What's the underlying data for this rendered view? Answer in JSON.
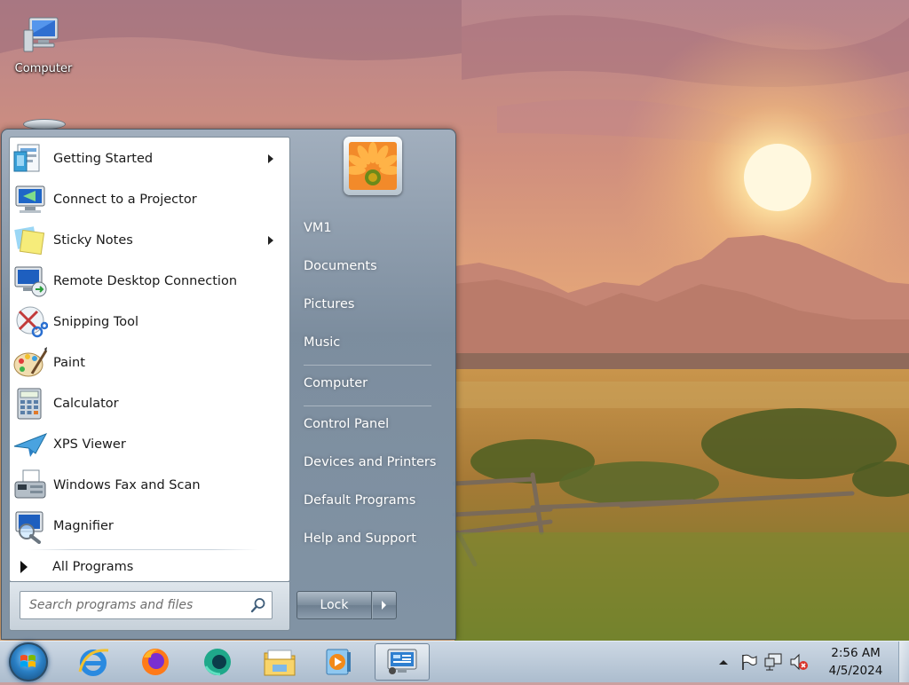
{
  "desktop": {
    "icons": [
      {
        "label": "Computer"
      }
    ]
  },
  "start_menu": {
    "programs": [
      {
        "label": "Getting Started",
        "icon": "getting-started-icon",
        "has_submenu": true
      },
      {
        "label": "Connect to a Projector",
        "icon": "projector-icon",
        "has_submenu": false
      },
      {
        "label": "Sticky Notes",
        "icon": "sticky-notes-icon",
        "has_submenu": true
      },
      {
        "label": "Remote Desktop Connection",
        "icon": "remote-desktop-icon",
        "has_submenu": false
      },
      {
        "label": "Snipping Tool",
        "icon": "scissors-icon",
        "has_submenu": false
      },
      {
        "label": "Paint",
        "icon": "paint-palette-icon",
        "has_submenu": false
      },
      {
        "label": "Calculator",
        "icon": "calculator-icon",
        "has_submenu": false
      },
      {
        "label": "XPS Viewer",
        "icon": "xps-viewer-icon",
        "has_submenu": false
      },
      {
        "label": "Windows Fax and Scan",
        "icon": "fax-icon",
        "has_submenu": false
      },
      {
        "label": "Magnifier",
        "icon": "magnifier-icon",
        "has_submenu": false
      }
    ],
    "all_programs_label": "All Programs",
    "search_placeholder": "Search programs and files",
    "right_items": [
      {
        "label": "VM1"
      },
      {
        "label": "Documents"
      },
      {
        "label": "Pictures"
      },
      {
        "label": "Music"
      },
      {
        "label": "Computer"
      },
      {
        "label": "Control Panel"
      },
      {
        "label": "Devices and Printers"
      },
      {
        "label": "Default Programs"
      },
      {
        "label": "Help and Support"
      }
    ],
    "lock_label": "Lock"
  },
  "taskbar": {
    "apps": [
      {
        "name": "internet-explorer-icon"
      },
      {
        "name": "firefox-icon"
      },
      {
        "name": "browser-app-icon"
      },
      {
        "name": "file-explorer-icon"
      },
      {
        "name": "media-player-icon"
      },
      {
        "name": "remote-desktop-app-icon"
      }
    ],
    "clock": {
      "time": "2:56 AM",
      "date": "4/5/2024"
    }
  },
  "colors": {
    "start_menu_glass": "#7d92a6",
    "taskbar": "#b7c9da",
    "text_dark": "#1a1a1a",
    "text_light": "#ffffff"
  }
}
